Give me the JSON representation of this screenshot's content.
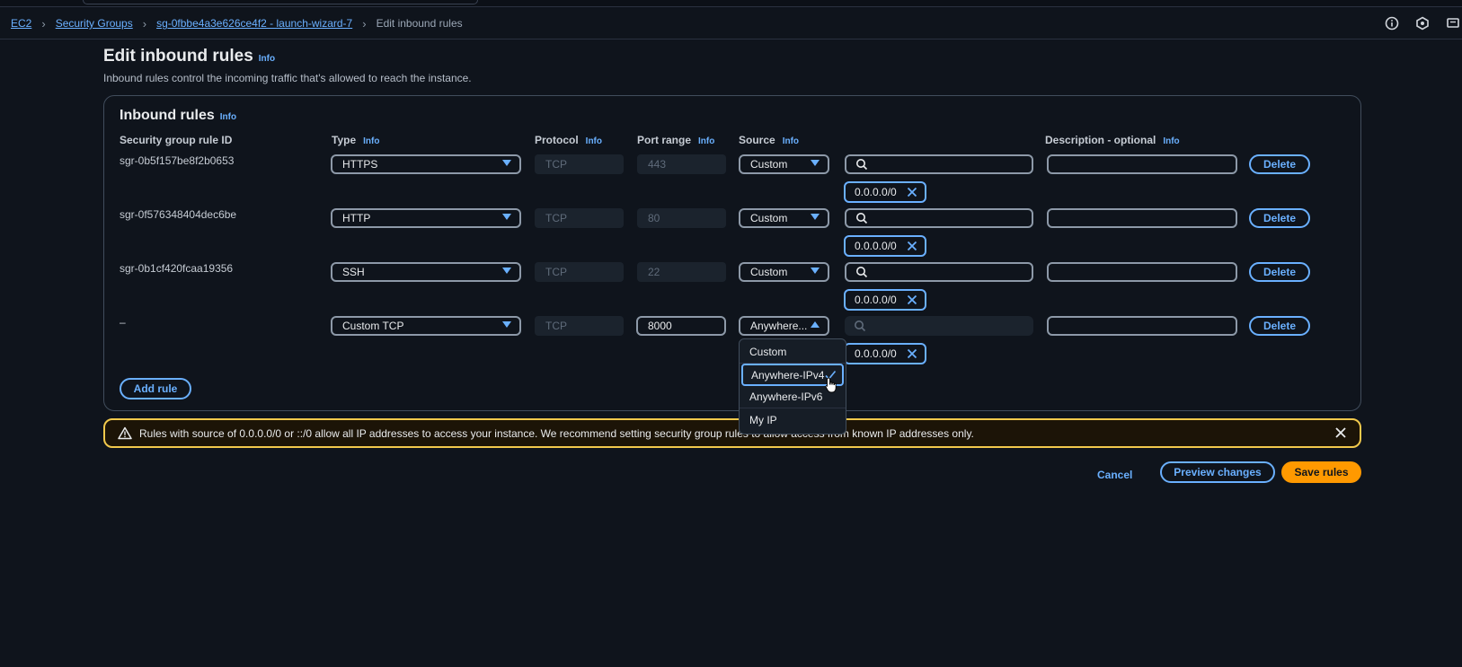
{
  "breadcrumb": {
    "items": [
      "EC2",
      "Security Groups",
      "sg-0fbbe4a3e626ce4f2 - launch-wizard-7"
    ],
    "current": "Edit inbound rules"
  },
  "page": {
    "title": "Edit inbound rules",
    "info": "Info",
    "description": "Inbound rules control the incoming traffic that's allowed to reach the instance."
  },
  "panel": {
    "title": "Inbound rules",
    "info": "Info",
    "columns": {
      "rule_id": "Security group rule ID",
      "type": "Type",
      "protocol": "Protocol",
      "port_range": "Port range",
      "source": "Source",
      "description": "Description - optional"
    },
    "info_label": "Info"
  },
  "rules": [
    {
      "id": "sgr-0b5f157be8f2b0653",
      "type": "HTTPS",
      "protocol": "TCP",
      "port": "443",
      "source": "Custom",
      "cidr": "0.0.0.0/0",
      "description": ""
    },
    {
      "id": "sgr-0f576348404dec6be",
      "type": "HTTP",
      "protocol": "TCP",
      "port": "80",
      "source": "Custom",
      "cidr": "0.0.0.0/0",
      "description": ""
    },
    {
      "id": "sgr-0b1cf420fcaa19356",
      "type": "SSH",
      "protocol": "TCP",
      "port": "22",
      "source": "Custom",
      "cidr": "0.0.0.0/0",
      "description": ""
    },
    {
      "id": "–",
      "type": "Custom TCP",
      "protocol": "TCP",
      "port": "8000",
      "source": "Anywhere...",
      "cidr": "0.0.0.0/0",
      "description": ""
    }
  ],
  "delete_label": "Delete",
  "add_rule_label": "Add rule",
  "source_dropdown": {
    "options": [
      "Custom",
      "Anywhere-IPv4",
      "Anywhere-IPv6",
      "My IP"
    ],
    "selected": "Anywhere-IPv4"
  },
  "warning": {
    "text": "Rules with source of 0.0.0.0/0 or ::/0 allow all IP addresses to access your instance. We recommend setting security group rules to allow access from known IP addresses only."
  },
  "footer": {
    "cancel": "Cancel",
    "preview": "Preview changes",
    "save": "Save rules"
  },
  "colors": {
    "background": "#0f141c",
    "link": "#6ab0ff",
    "primary": "#ff9900",
    "warning_border": "#f2c94c"
  },
  "icons": [
    "info-circle-icon",
    "hexagon-icon",
    "notifications-icon",
    "search-icon",
    "close-icon",
    "chevron-right-icon",
    "caret-down-icon",
    "caret-up-icon",
    "check-icon",
    "warning-icon",
    "pointer-cursor-icon"
  ]
}
